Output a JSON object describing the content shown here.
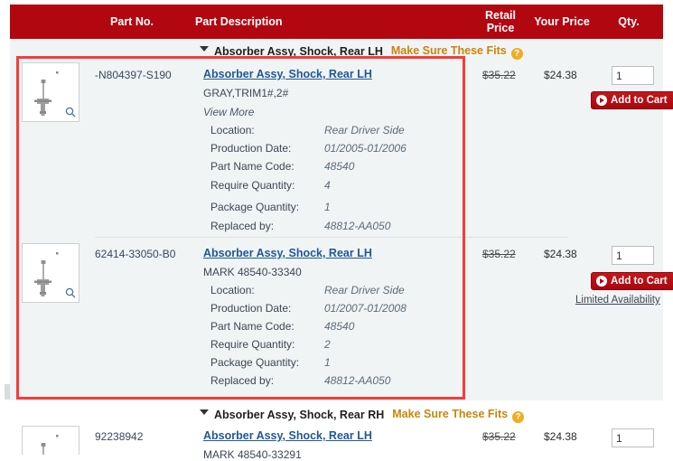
{
  "table": {
    "columns": {
      "part_no": "Part No.",
      "description": "Part Description",
      "retail_price": "Retail Price",
      "your_price": "Your Price",
      "qty": "Qty."
    }
  },
  "groups": [
    {
      "title": "Absorber Assy, Shock, Rear LH",
      "fits_label": "Make Sure These Fits",
      "help_icon": "question-mark-icon",
      "caret_icon": "caret-down-icon"
    },
    {
      "title": "Absorber Assy, Shock, Rear RH",
      "fits_label": "Make Sure These Fits",
      "help_icon": "question-mark-icon",
      "caret_icon": "caret-down-icon"
    }
  ],
  "rows": [
    {
      "part_no": "-N804397-S190",
      "title": "Absorber Assy, Shock, Rear LH",
      "subtitle": "GRAY,TRIM1#,2#",
      "view_more": "View More",
      "specs": [
        {
          "label": "Location:",
          "value": "Rear Driver Side"
        },
        {
          "label": "Production Date:",
          "value": "01/2005-01/2006"
        },
        {
          "label": "Part Name Code:",
          "value": "48540"
        },
        {
          "label": "Require Quantity:",
          "value": "4"
        },
        {
          "label": "Package Quantity:",
          "value": "1"
        },
        {
          "label": "Replaced by:",
          "value": "48812-AA050"
        }
      ],
      "retail_price": "$35.22",
      "your_price": "$24.38",
      "qty_value": "1",
      "add_to_cart": "Add to Cart",
      "availability": ""
    },
    {
      "part_no": "62414-33050-B0",
      "title": "Absorber Assy, Shock, Rear LH",
      "subtitle": "MARK 48540-33340",
      "view_more": "",
      "specs": [
        {
          "label": "Location:",
          "value": "Rear Driver Side"
        },
        {
          "label": "Production Date:",
          "value": "01/2007-01/2008"
        },
        {
          "label": "Part Name Code:",
          "value": "48540"
        },
        {
          "label": "Require Quantity:",
          "value": "2"
        },
        {
          "label": "Package Quantity:",
          "value": "1"
        },
        {
          "label": "Replaced by:",
          "value": "48812-AA050"
        }
      ],
      "retail_price": "$35.22",
      "your_price": "$24.38",
      "qty_value": "1",
      "add_to_cart": "Add to Cart",
      "availability": "Limited Availability"
    },
    {
      "part_no": "92238942",
      "title": "Absorber Assy, Shock, Rear LH",
      "subtitle": "MARK 48540-33291",
      "view_more": "",
      "specs": [],
      "retail_price": "$35.22",
      "your_price": "$24.38",
      "qty_value": "1",
      "add_to_cart": "",
      "availability": ""
    }
  ],
  "colors": {
    "header_red": "#b20710",
    "highlight_red": "#f93b39",
    "link_blue": "#1f5896",
    "fits_gold": "#c8860d"
  }
}
